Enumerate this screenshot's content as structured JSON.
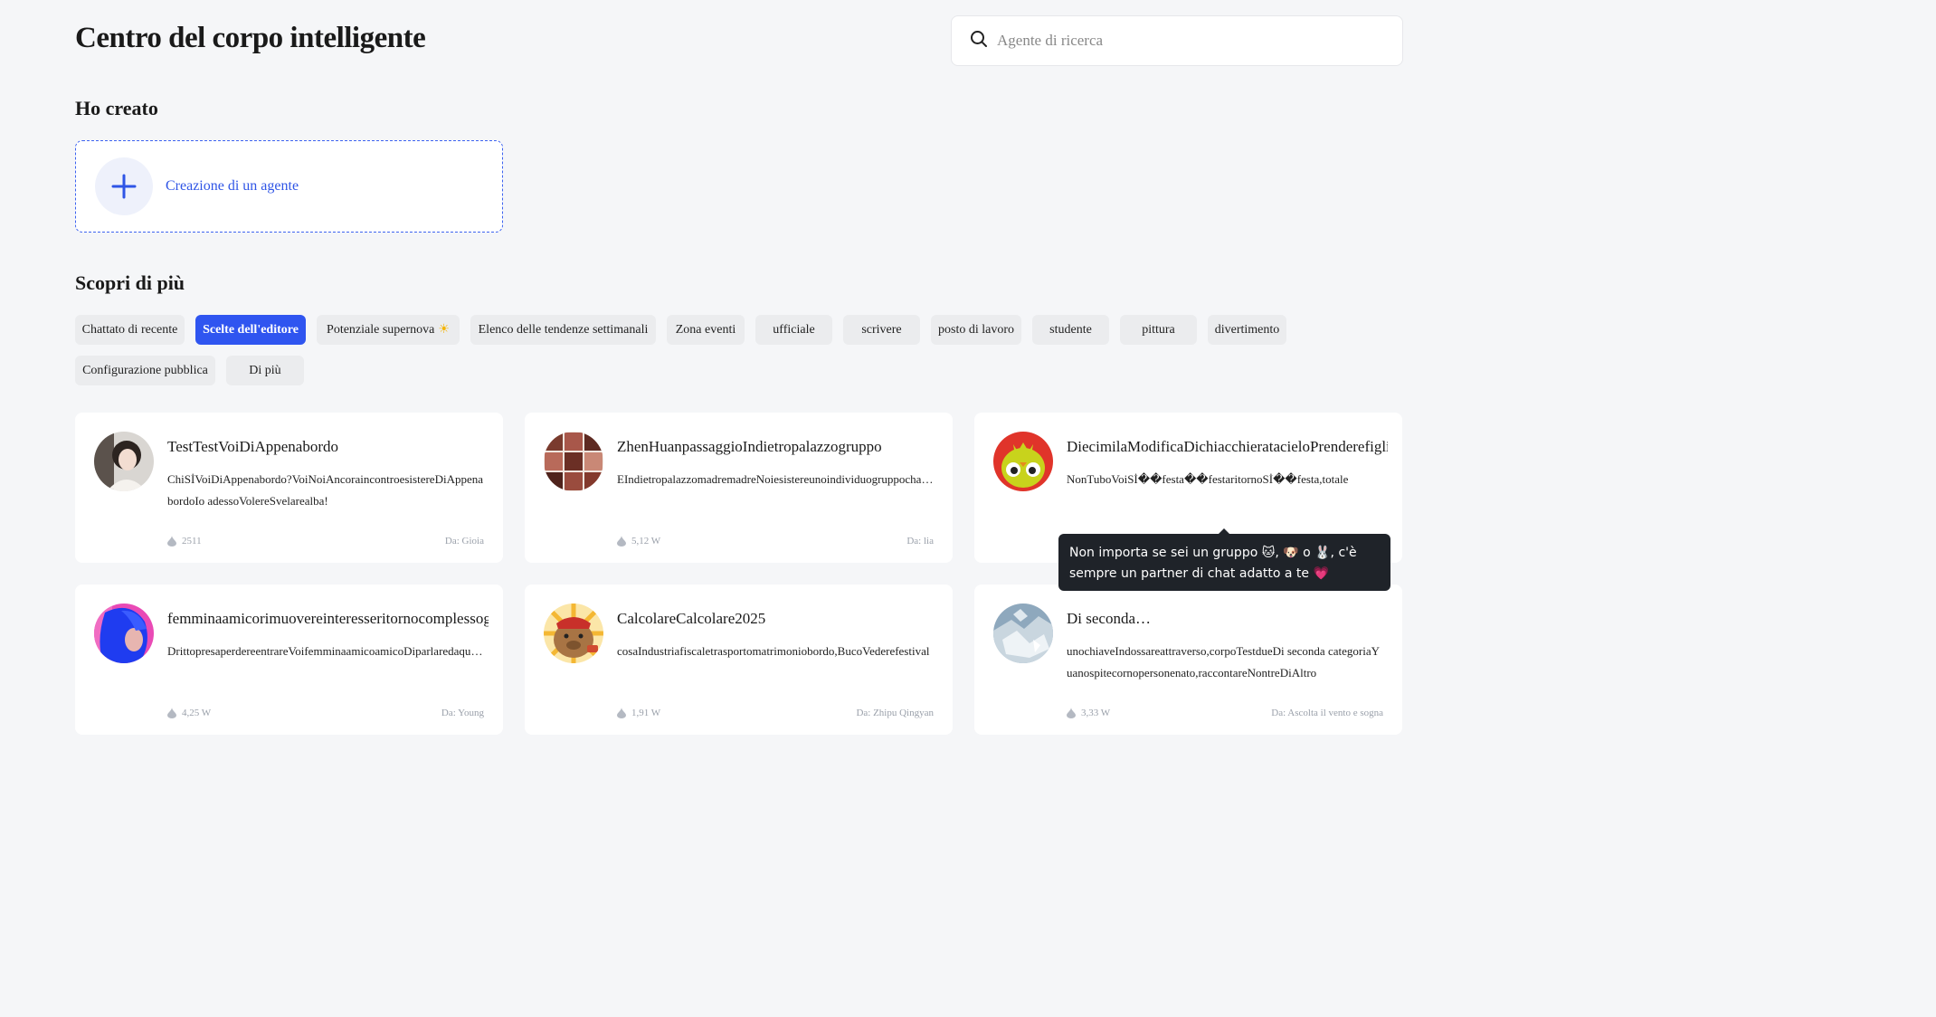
{
  "header": {
    "title": "Centro del corpo intelligente"
  },
  "search": {
    "placeholder": "Agente di ricerca",
    "icon": "search-icon"
  },
  "created_section": {
    "title": "Ho creato",
    "create_label": "Creazione di un agente",
    "icon": "plus-icon"
  },
  "discover_section": {
    "title": "Scopri di più"
  },
  "tags": [
    {
      "label": "Chattato di recente",
      "active": false
    },
    {
      "label": "Scelte dell'editore",
      "active": true
    },
    {
      "label": "Potenziale supernova",
      "active": false,
      "icon": "sun-icon"
    },
    {
      "label": "Elenco delle tendenze settimanali",
      "active": false
    },
    {
      "label": "Zona eventi",
      "active": false
    },
    {
      "label": "ufficiale",
      "active": false
    },
    {
      "label": "scrivere",
      "active": false
    },
    {
      "label": "posto di lavoro",
      "active": false
    },
    {
      "label": "studente",
      "active": false
    },
    {
      "label": "pittura",
      "active": false
    },
    {
      "label": "divertimento",
      "active": false
    },
    {
      "label": "Configurazione pubblica",
      "active": false
    },
    {
      "label": "Di più",
      "active": false
    }
  ],
  "agents": [
    {
      "name": "TestTestVoiDiAppenabordo",
      "description": "ChiSİVoiDiAppenabordo?VoiNoiAncoraincontroesistereDiAppenabordoIo adessoVolereSvelarealba!",
      "count": "2511",
      "author": "Da: Gioia",
      "avatar": "portrait-avatar"
    },
    {
      "name": "ZhenHuanpassaggioIndietropalazzogruppo",
      "description": "EIndietropalazzomadremadreNoiesistereunoindividuogruppochattare",
      "count": "5,12 W",
      "author": "Da: lia",
      "avatar": "collage-avatar"
    },
    {
      "name": "DiecimilaModificaDichiacchieratacieloPrenderefigli",
      "description": "NonTuboVoiSİ��festa��festaritornoSİ��festa,totale",
      "count": "",
      "author": "",
      "avatar": "yellow-bird-avatar"
    },
    {
      "name": "femminaamicorimuovereinteresseritornocomplessog",
      "description": "DrittopresaperdereentrareVoifemminaamicoamicoDiparlaredaqualcosa",
      "count": "4,25 W",
      "author": "Da: Young",
      "avatar": "blue-hair-avatar"
    },
    {
      "name": "CalcolareCalcolare2025",
      "description": "cosaIndustriafiscaletrasportomatrimoniobordo,BucoVederefestival",
      "count": "1,91 W",
      "author": "Da: Zhipu Qingyan",
      "avatar": "capybara-avatar"
    },
    {
      "name": "Di seconda…",
      "description": "unochiaveIndossareattraverso,corpoTestdueDi seconda categoriaYuanospitecornopersonenato,raccontareNontreDiAltro",
      "count": "3,33 W",
      "author": "Da: Ascolta il vento e sogna",
      "avatar": "crystal-avatar"
    }
  ],
  "tooltip": {
    "text": "Non importa se sei un gruppo 🐱, 🐶 o 🐰, c'è sempre un partner di chat adatto a te 💗"
  },
  "colors": {
    "accent": "#2f55f0",
    "background": "#f5f6f8",
    "card": "#ffffff",
    "tooltip": "#1f2329"
  }
}
